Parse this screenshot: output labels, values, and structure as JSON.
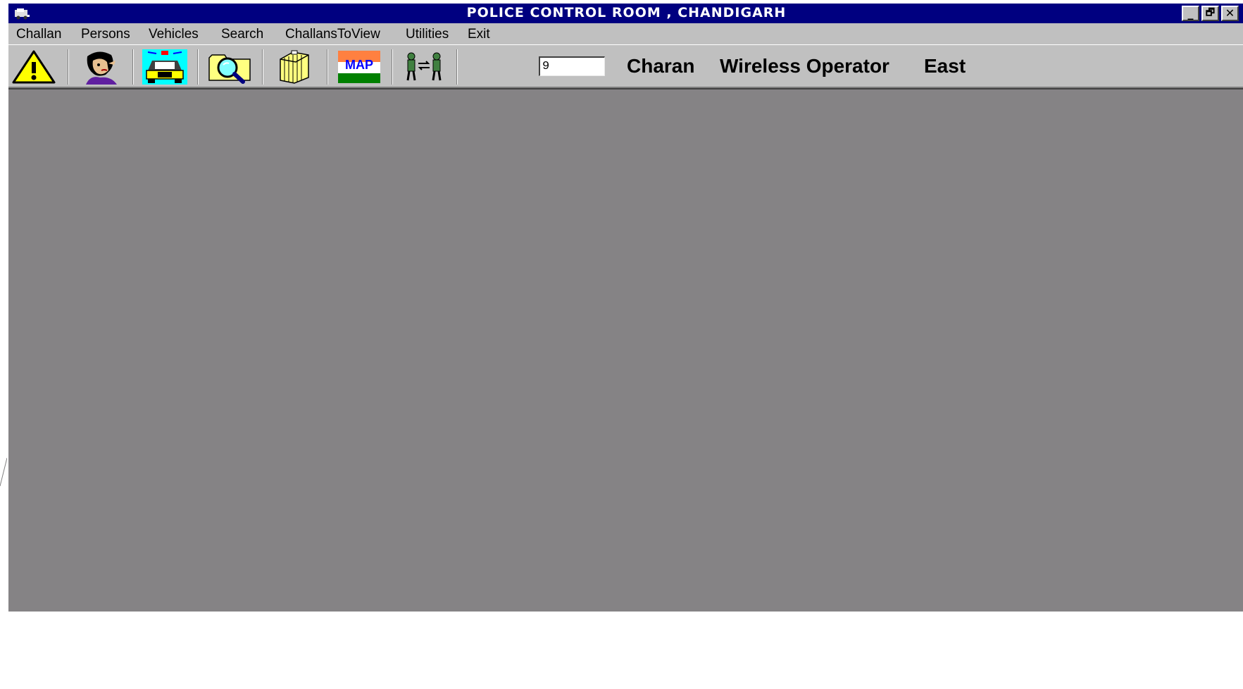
{
  "window": {
    "title": "POLICE CONTROL ROOM , CHANDIGARH",
    "buttons": {
      "minimize": "_",
      "restore": "🗗",
      "close": "✕"
    }
  },
  "menu": [
    {
      "label": "Challan"
    },
    {
      "label": "Persons"
    },
    {
      "label": "Vehicles"
    },
    {
      "label": "Search"
    },
    {
      "label": "ChallansToView"
    },
    {
      "label": "Utilities"
    },
    {
      "label": "Exit"
    }
  ],
  "toolbar": {
    "icons": [
      "warning-icon",
      "person-icon",
      "police-car-icon",
      "search-folder-icon",
      "files-icon",
      "map-icon",
      "officers-exchange-icon"
    ],
    "map_label": "MAP",
    "shift_value": "9",
    "operator_name": "Charan",
    "operator_role": "Wireless Operator",
    "zone": "East"
  },
  "colors": {
    "titlebar": "#000080",
    "face": "#c0c0c0",
    "workspace": "#858385"
  }
}
